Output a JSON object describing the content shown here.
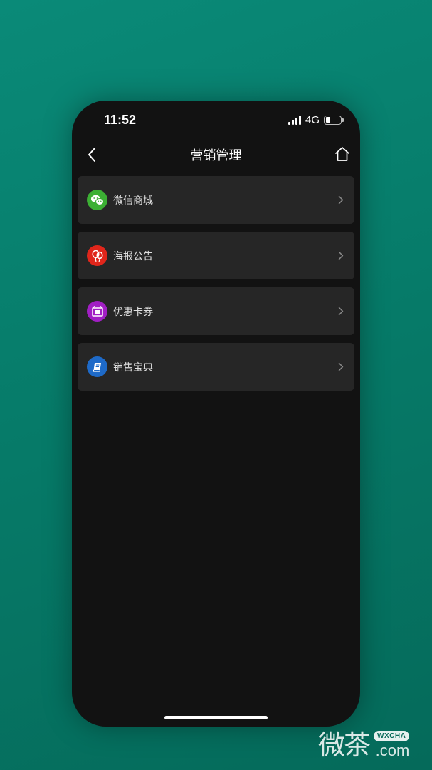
{
  "status_bar": {
    "time": "11:52",
    "network": "4G",
    "battery_level": 0.32
  },
  "nav": {
    "title": "营销管理",
    "back_icon": "back-chevron-icon",
    "home_icon": "home-icon"
  },
  "menu": {
    "items": [
      {
        "label": "微信商城",
        "icon": "wechat-icon",
        "color": "#3cb034"
      },
      {
        "label": "海报公告",
        "icon": "balloon-icon",
        "color": "#e0261b"
      },
      {
        "label": "优惠卡券",
        "icon": "coupon-icon",
        "color": "#a11fc4"
      },
      {
        "label": "销售宝典",
        "icon": "book-icon",
        "color": "#1e6ac8"
      }
    ]
  },
  "watermark": {
    "cn": "微茶",
    "badge": "WXCHA",
    "domain": ".com"
  }
}
